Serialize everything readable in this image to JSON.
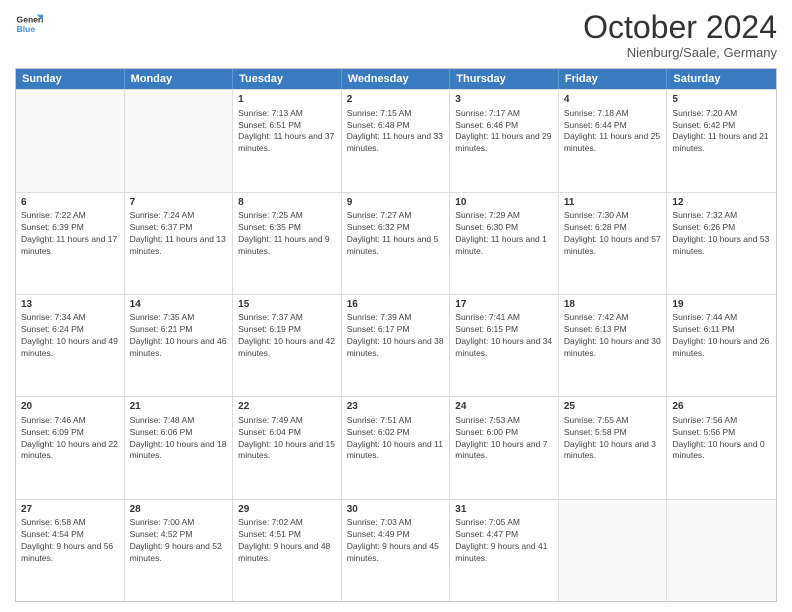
{
  "logo": {
    "line1": "General",
    "line2": "Blue"
  },
  "header": {
    "title": "October 2024",
    "subtitle": "Nienburg/Saale, Germany"
  },
  "weekdays": [
    "Sunday",
    "Monday",
    "Tuesday",
    "Wednesday",
    "Thursday",
    "Friday",
    "Saturday"
  ],
  "rows": [
    [
      {
        "num": "",
        "info": "",
        "empty": true
      },
      {
        "num": "",
        "info": "",
        "empty": true
      },
      {
        "num": "1",
        "info": "Sunrise: 7:13 AM\nSunset: 6:51 PM\nDaylight: 11 hours and 37 minutes."
      },
      {
        "num": "2",
        "info": "Sunrise: 7:15 AM\nSunset: 6:48 PM\nDaylight: 11 hours and 33 minutes."
      },
      {
        "num": "3",
        "info": "Sunrise: 7:17 AM\nSunset: 6:46 PM\nDaylight: 11 hours and 29 minutes."
      },
      {
        "num": "4",
        "info": "Sunrise: 7:18 AM\nSunset: 6:44 PM\nDaylight: 11 hours and 25 minutes."
      },
      {
        "num": "5",
        "info": "Sunrise: 7:20 AM\nSunset: 6:42 PM\nDaylight: 11 hours and 21 minutes."
      }
    ],
    [
      {
        "num": "6",
        "info": "Sunrise: 7:22 AM\nSunset: 6:39 PM\nDaylight: 11 hours and 17 minutes."
      },
      {
        "num": "7",
        "info": "Sunrise: 7:24 AM\nSunset: 6:37 PM\nDaylight: 11 hours and 13 minutes."
      },
      {
        "num": "8",
        "info": "Sunrise: 7:25 AM\nSunset: 6:35 PM\nDaylight: 11 hours and 9 minutes."
      },
      {
        "num": "9",
        "info": "Sunrise: 7:27 AM\nSunset: 6:32 PM\nDaylight: 11 hours and 5 minutes."
      },
      {
        "num": "10",
        "info": "Sunrise: 7:29 AM\nSunset: 6:30 PM\nDaylight: 11 hours and 1 minute."
      },
      {
        "num": "11",
        "info": "Sunrise: 7:30 AM\nSunset: 6:28 PM\nDaylight: 10 hours and 57 minutes."
      },
      {
        "num": "12",
        "info": "Sunrise: 7:32 AM\nSunset: 6:26 PM\nDaylight: 10 hours and 53 minutes."
      }
    ],
    [
      {
        "num": "13",
        "info": "Sunrise: 7:34 AM\nSunset: 6:24 PM\nDaylight: 10 hours and 49 minutes."
      },
      {
        "num": "14",
        "info": "Sunrise: 7:35 AM\nSunset: 6:21 PM\nDaylight: 10 hours and 46 minutes."
      },
      {
        "num": "15",
        "info": "Sunrise: 7:37 AM\nSunset: 6:19 PM\nDaylight: 10 hours and 42 minutes."
      },
      {
        "num": "16",
        "info": "Sunrise: 7:39 AM\nSunset: 6:17 PM\nDaylight: 10 hours and 38 minutes."
      },
      {
        "num": "17",
        "info": "Sunrise: 7:41 AM\nSunset: 6:15 PM\nDaylight: 10 hours and 34 minutes."
      },
      {
        "num": "18",
        "info": "Sunrise: 7:42 AM\nSunset: 6:13 PM\nDaylight: 10 hours and 30 minutes."
      },
      {
        "num": "19",
        "info": "Sunrise: 7:44 AM\nSunset: 6:11 PM\nDaylight: 10 hours and 26 minutes."
      }
    ],
    [
      {
        "num": "20",
        "info": "Sunrise: 7:46 AM\nSunset: 6:09 PM\nDaylight: 10 hours and 22 minutes."
      },
      {
        "num": "21",
        "info": "Sunrise: 7:48 AM\nSunset: 6:06 PM\nDaylight: 10 hours and 18 minutes."
      },
      {
        "num": "22",
        "info": "Sunrise: 7:49 AM\nSunset: 6:04 PM\nDaylight: 10 hours and 15 minutes."
      },
      {
        "num": "23",
        "info": "Sunrise: 7:51 AM\nSunset: 6:02 PM\nDaylight: 10 hours and 11 minutes."
      },
      {
        "num": "24",
        "info": "Sunrise: 7:53 AM\nSunset: 6:00 PM\nDaylight: 10 hours and 7 minutes."
      },
      {
        "num": "25",
        "info": "Sunrise: 7:55 AM\nSunset: 5:58 PM\nDaylight: 10 hours and 3 minutes."
      },
      {
        "num": "26",
        "info": "Sunrise: 7:56 AM\nSunset: 5:56 PM\nDaylight: 10 hours and 0 minutes."
      }
    ],
    [
      {
        "num": "27",
        "info": "Sunrise: 6:58 AM\nSunset: 4:54 PM\nDaylight: 9 hours and 56 minutes."
      },
      {
        "num": "28",
        "info": "Sunrise: 7:00 AM\nSunset: 4:52 PM\nDaylight: 9 hours and 52 minutes."
      },
      {
        "num": "29",
        "info": "Sunrise: 7:02 AM\nSunset: 4:51 PM\nDaylight: 9 hours and 48 minutes."
      },
      {
        "num": "30",
        "info": "Sunrise: 7:03 AM\nSunset: 4:49 PM\nDaylight: 9 hours and 45 minutes."
      },
      {
        "num": "31",
        "info": "Sunrise: 7:05 AM\nSunset: 4:47 PM\nDaylight: 9 hours and 41 minutes."
      },
      {
        "num": "",
        "info": "",
        "empty": true
      },
      {
        "num": "",
        "info": "",
        "empty": true
      }
    ]
  ]
}
